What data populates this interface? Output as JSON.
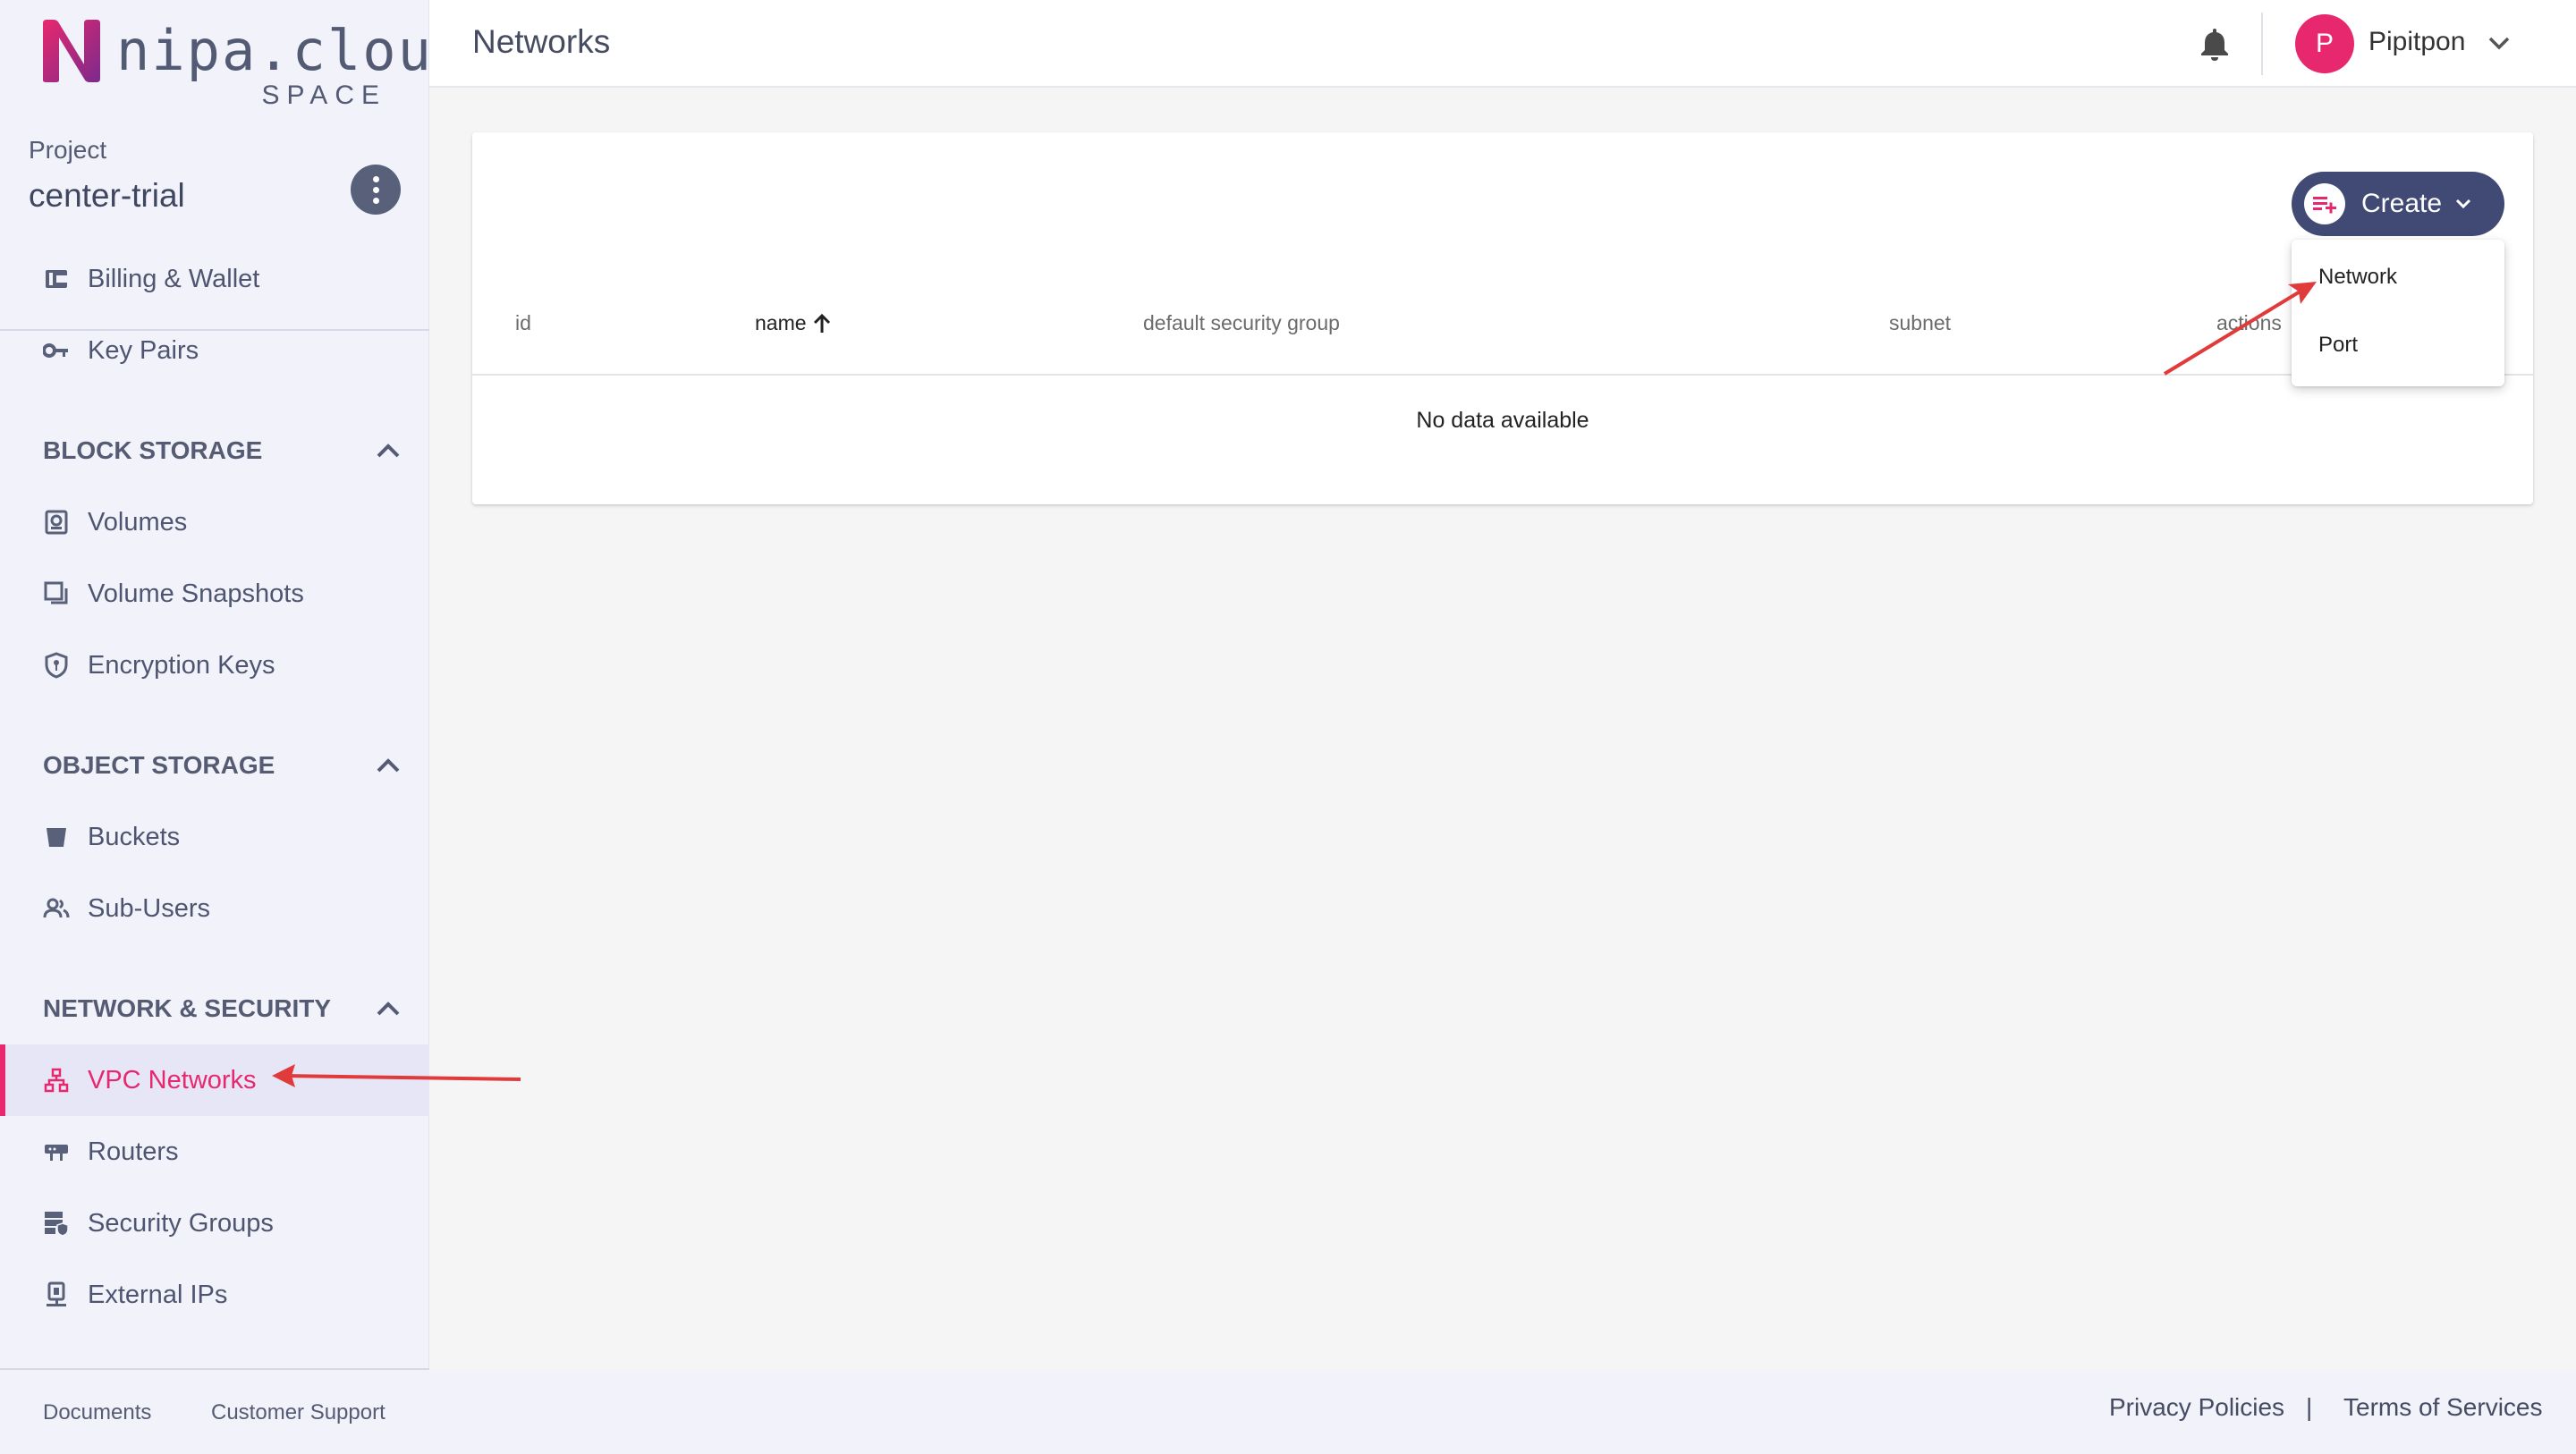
{
  "brand": {
    "name": "nipa.cloud",
    "sub": "SPACE",
    "colors": {
      "accent": "#e8286e",
      "primary": "#414a74",
      "logo_gradient": [
        "#e8286e",
        "#7b2a8c"
      ]
    }
  },
  "project": {
    "label": "Project",
    "name": "center-trial"
  },
  "sidebar": {
    "top_items": [
      {
        "label": "Billing & Wallet",
        "icon": "wallet-icon"
      },
      {
        "label": "Key Pairs",
        "icon": "key-icon"
      }
    ],
    "sections": [
      {
        "title": "BLOCK STORAGE",
        "items": [
          {
            "label": "Volumes",
            "icon": "volume-icon"
          },
          {
            "label": "Volume Snapshots",
            "icon": "snapshot-icon"
          },
          {
            "label": "Encryption Keys",
            "icon": "shield-key-icon"
          }
        ]
      },
      {
        "title": "OBJECT STORAGE",
        "items": [
          {
            "label": "Buckets",
            "icon": "bucket-icon"
          },
          {
            "label": "Sub-Users",
            "icon": "users-icon"
          }
        ]
      },
      {
        "title": "NETWORK & SECURITY",
        "items": [
          {
            "label": "VPC Networks",
            "icon": "network-icon",
            "active": true
          },
          {
            "label": "Routers",
            "icon": "router-icon"
          },
          {
            "label": "Security Groups",
            "icon": "security-group-icon"
          },
          {
            "label": "External IPs",
            "icon": "external-ip-icon"
          }
        ]
      }
    ],
    "footer": {
      "documents": "Documents",
      "support": "Customer Support"
    }
  },
  "header": {
    "title": "Networks",
    "user": {
      "initial": "P",
      "name": "Pipitpon"
    }
  },
  "table": {
    "columns": [
      "id",
      "name",
      "default security group",
      "subnet",
      "actions"
    ],
    "sorted_column": "name",
    "sort_direction": "ascending",
    "empty_text": "No data available"
  },
  "create": {
    "label": "Create",
    "menu": [
      "Network",
      "Port"
    ]
  },
  "footer": {
    "privacy": "Privacy Policies",
    "separator": "|",
    "terms": "Terms of Services"
  }
}
